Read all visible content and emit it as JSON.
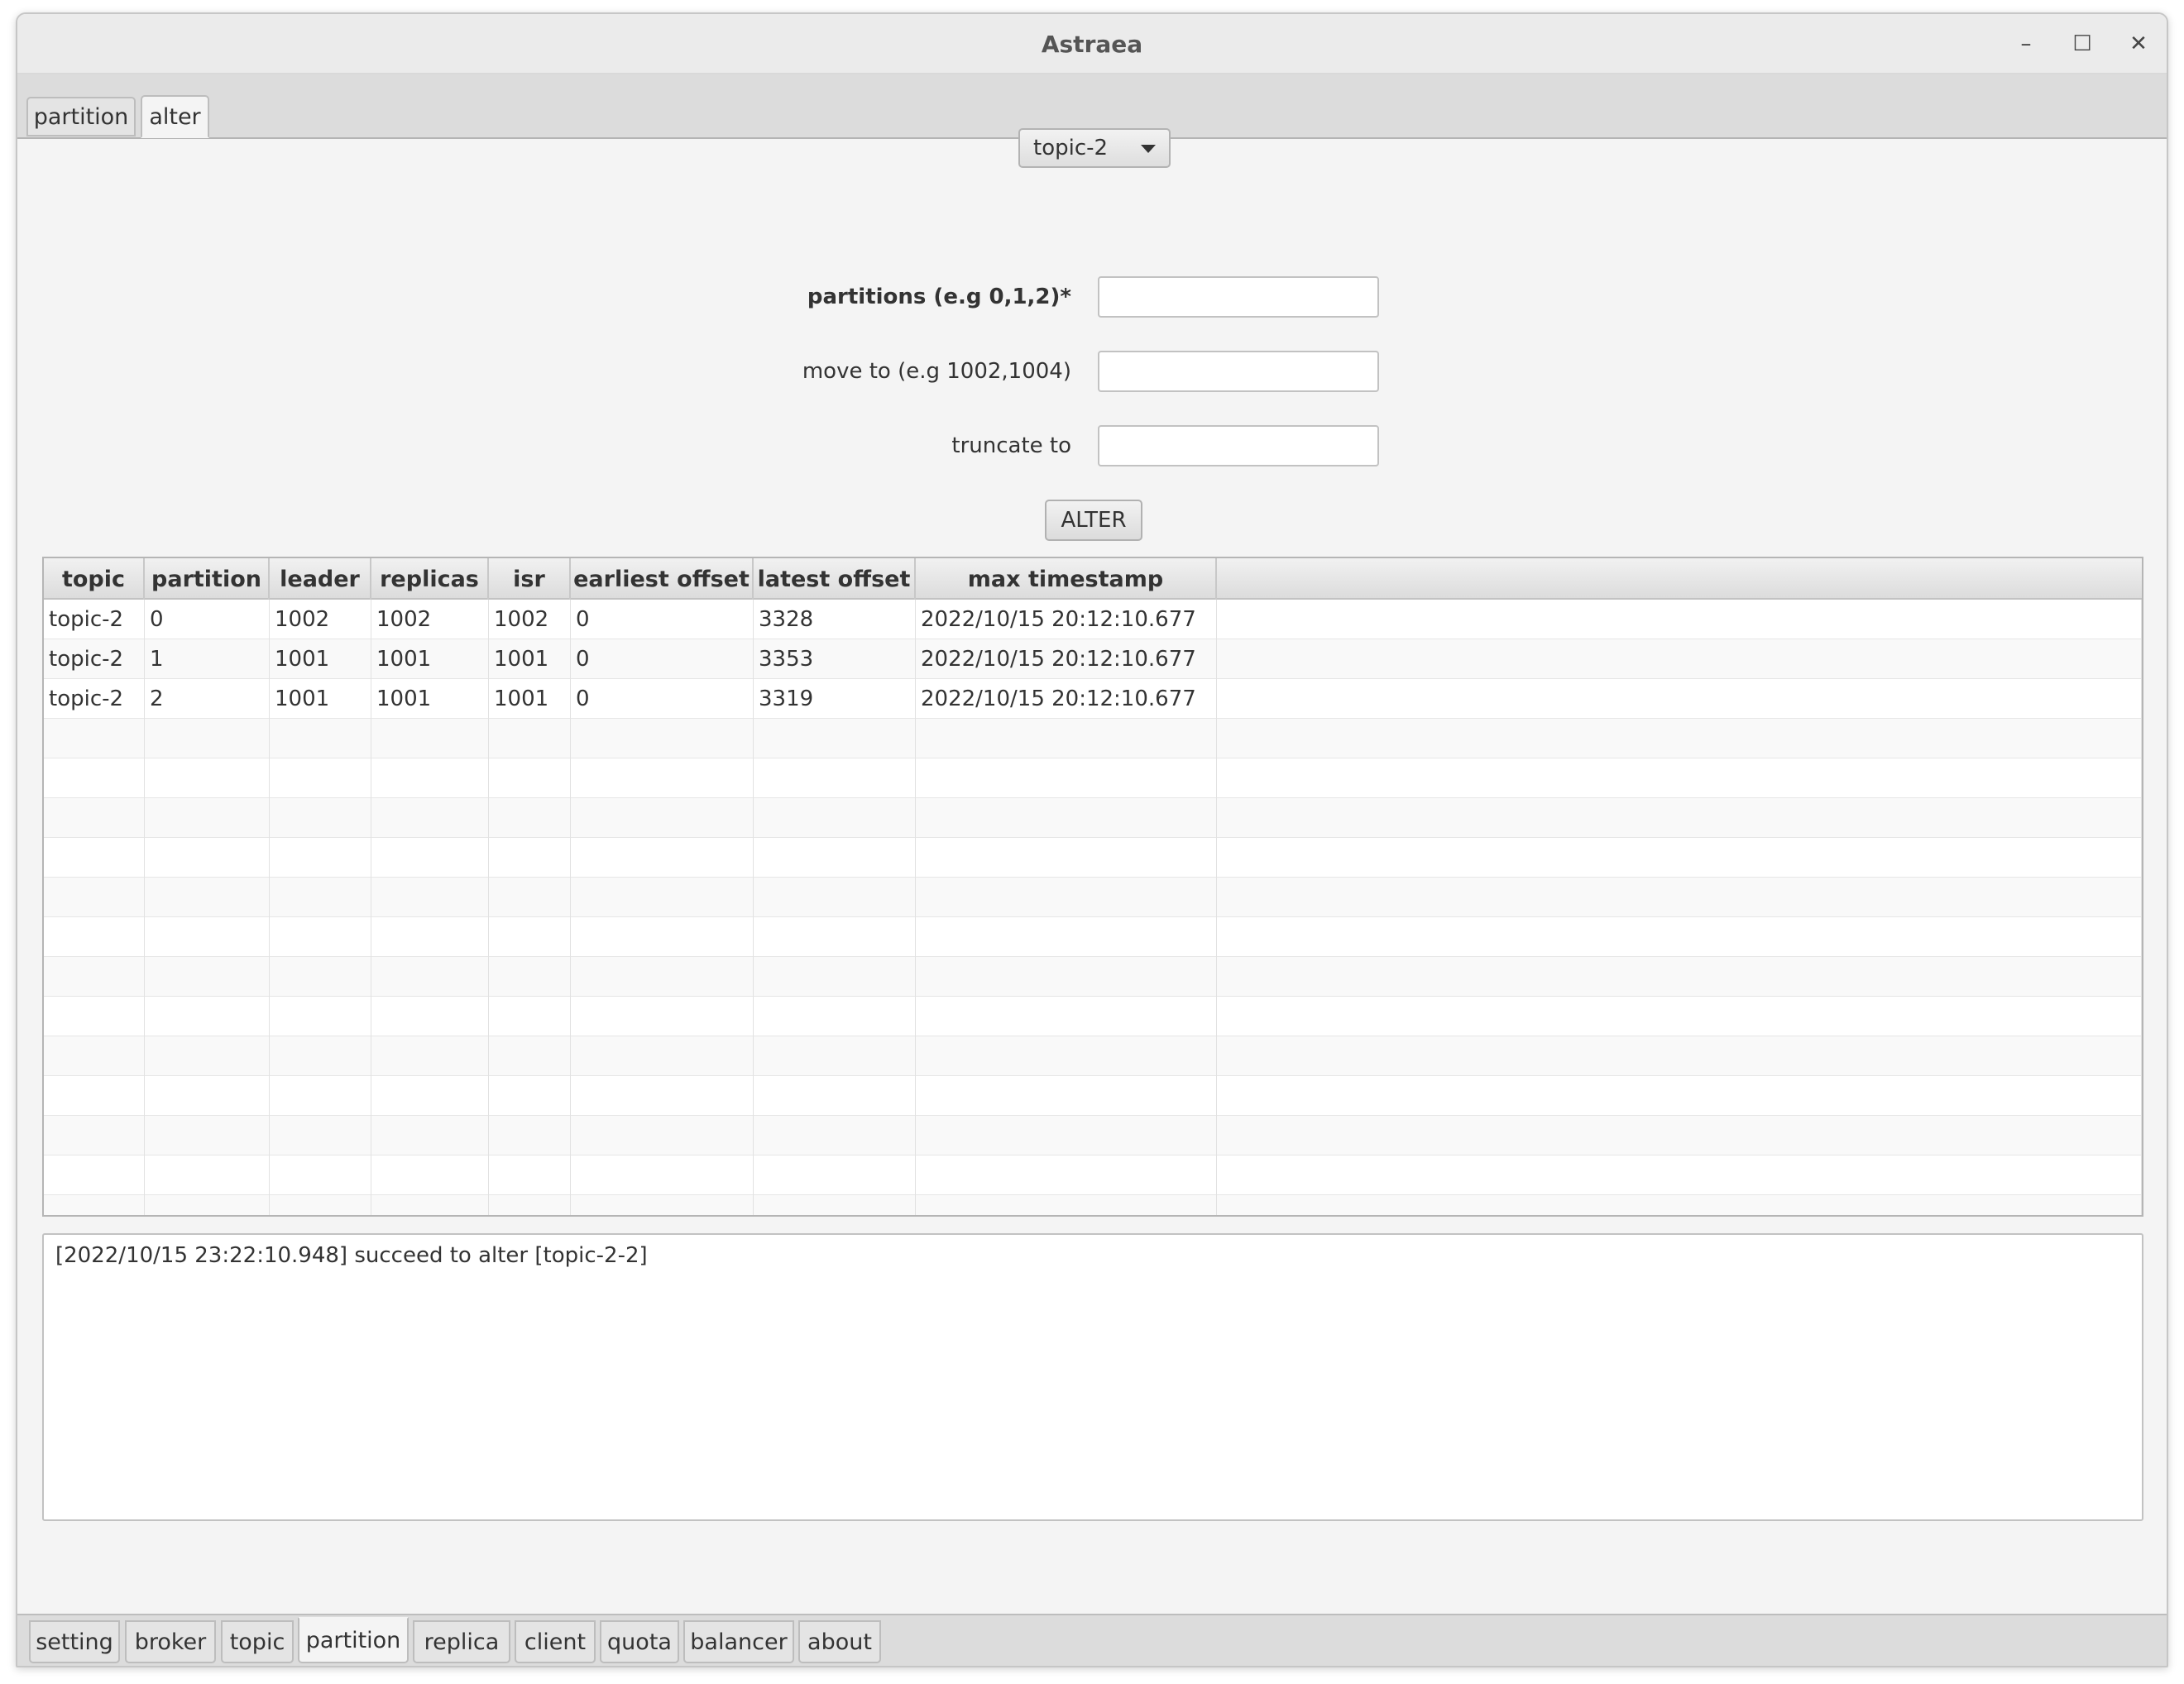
{
  "window": {
    "title": "Astraea",
    "controls": {
      "minimize": "–",
      "maximize": "☐",
      "close": "✕"
    }
  },
  "top_tabs": [
    {
      "label": "partition",
      "active": false
    },
    {
      "label": "alter",
      "active": true
    }
  ],
  "topic_select": {
    "value": "topic-2"
  },
  "form": {
    "partitions_label": "partitions (e.g 0,1,2)*",
    "partitions_value": "",
    "move_to_label": "move to (e.g 1002,1004)",
    "move_to_value": "",
    "truncate_to_label": "truncate to",
    "truncate_to_value": "",
    "alter_button": "ALTER"
  },
  "table": {
    "columns": [
      "topic",
      "partition",
      "leader",
      "replicas",
      "isr",
      "earliest offset",
      "latest offset",
      "max timestamp"
    ],
    "rows": [
      [
        "topic-2",
        "0",
        "1002",
        "1002",
        "1002",
        "0",
        "3328",
        "2022/10/15 20:12:10.677"
      ],
      [
        "topic-2",
        "1",
        "1001",
        "1001",
        "1001",
        "0",
        "3353",
        "2022/10/15 20:12:10.677"
      ],
      [
        "topic-2",
        "2",
        "1001",
        "1001",
        "1001",
        "0",
        "3319",
        "2022/10/15 20:12:10.677"
      ]
    ]
  },
  "log": {
    "text": "[2022/10/15 23:22:10.948] succeed to alter [topic-2-2]"
  },
  "bottom_tabs": [
    {
      "label": "setting",
      "active": false
    },
    {
      "label": "broker",
      "active": false
    },
    {
      "label": "topic",
      "active": false
    },
    {
      "label": "partition",
      "active": true
    },
    {
      "label": "replica",
      "active": false
    },
    {
      "label": "client",
      "active": false
    },
    {
      "label": "quota",
      "active": false
    },
    {
      "label": "balancer",
      "active": false
    },
    {
      "label": "about",
      "active": false
    }
  ]
}
